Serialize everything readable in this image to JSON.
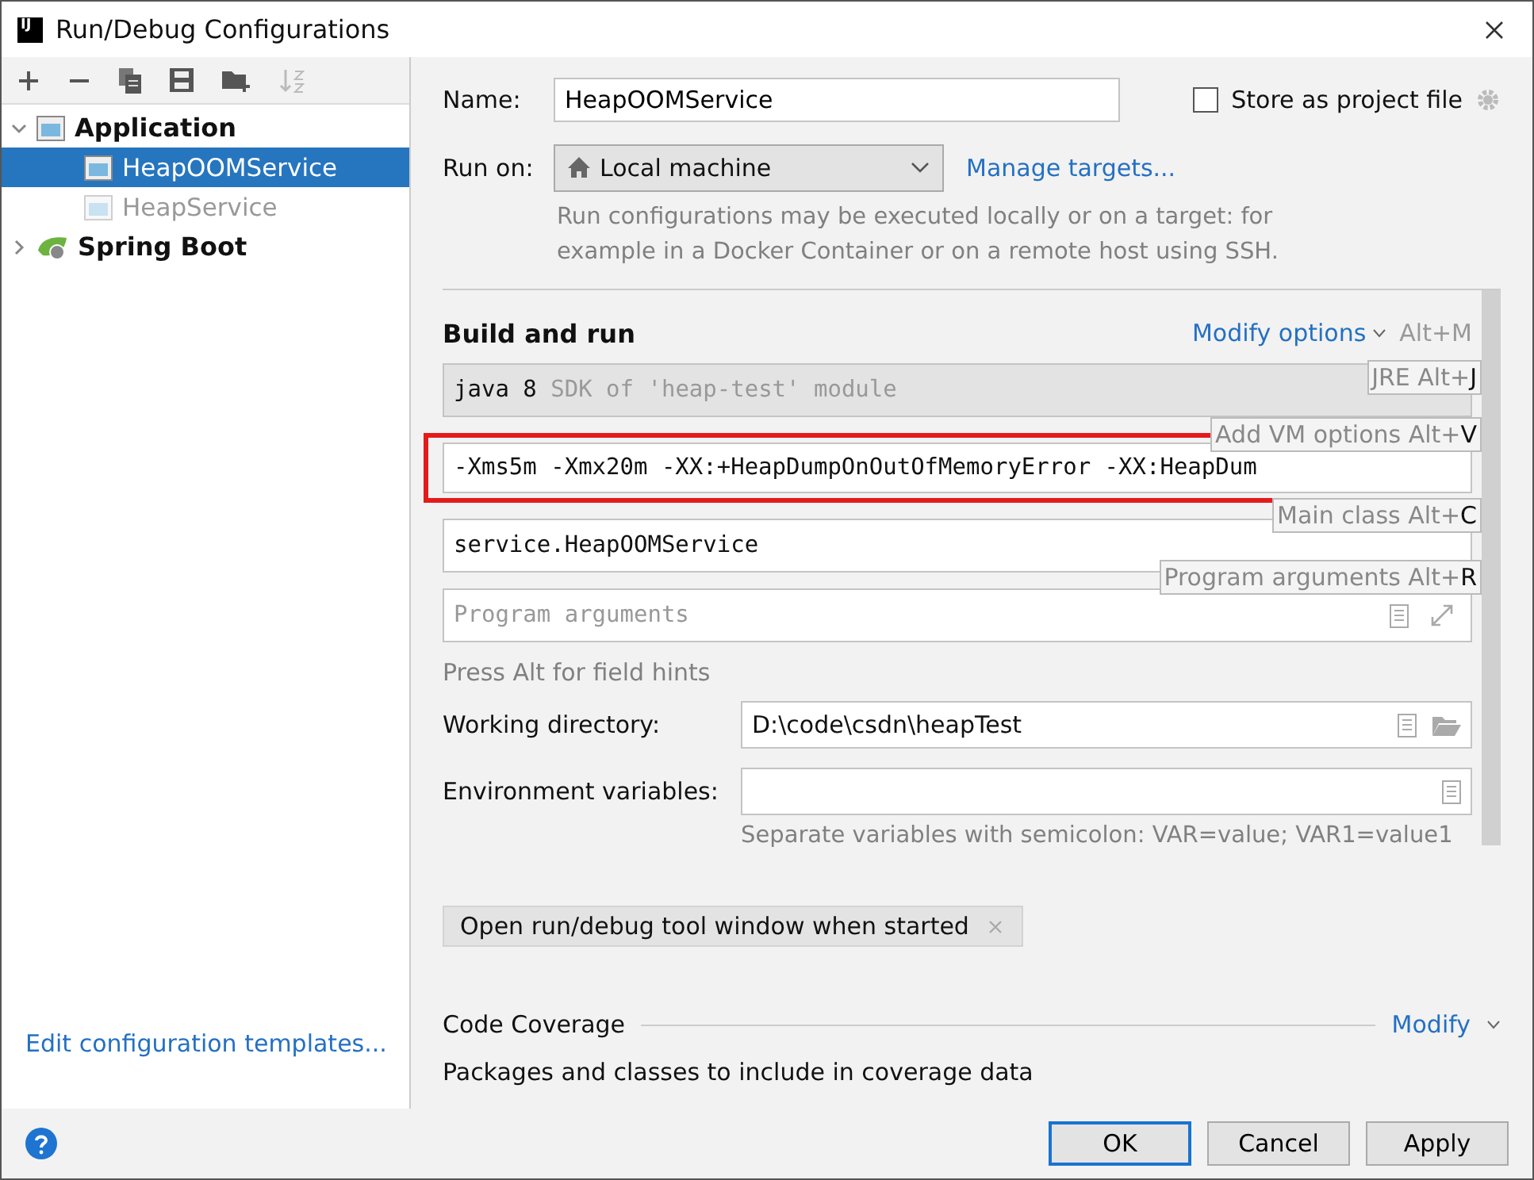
{
  "window": {
    "title": "Run/Debug Configurations",
    "logo": "IJ"
  },
  "tree": [
    {
      "label": "Application",
      "kind": "group",
      "expanded": true,
      "children": [
        {
          "label": "HeapOOMService",
          "selected": true,
          "temporary": false
        },
        {
          "label": "HeapService",
          "selected": false,
          "temporary": true
        }
      ]
    },
    {
      "label": "Spring Boot",
      "kind": "spring",
      "expanded": false
    }
  ],
  "edit_templates_link": "Edit configuration templates...",
  "name": {
    "label": "Name:",
    "value": "HeapOOMService"
  },
  "store_as_project_file": {
    "label": "Store as project file",
    "checked": false
  },
  "run_on": {
    "label": "Run on:",
    "value": "Local machine",
    "link": "Manage targets...",
    "hint": "Run configurations may be executed locally or on a target: for example in a Docker Container or on a remote host using SSH."
  },
  "build_and_run": {
    "title": "Build and run",
    "modify_link": "Modify options",
    "modify_shortcut": "Alt+M",
    "jre": {
      "value": "java 8",
      "hint": "SDK of 'heap-test' module"
    },
    "vm_options": {
      "value": "-Xms5m -Xmx20m -XX:+HeapDumpOnOutOfMemoryError -XX:HeapDum",
      "highlighted": true
    },
    "main_class": {
      "value": "service.HeapOOMService"
    },
    "program_arguments": {
      "placeholder": "Program arguments"
    },
    "tooltips": [
      {
        "text": "JRE Alt+",
        "key": "J"
      },
      {
        "text": "Add VM options Alt+",
        "key": "V"
      },
      {
        "text": "Main class Alt+",
        "key": "C"
      },
      {
        "text": "Program arguments Alt+",
        "key": "R"
      }
    ]
  },
  "field_hints_note": "Press Alt for field hints",
  "working_directory": {
    "label": "Working directory:",
    "value": "D:\\code\\csdn\\heapTest"
  },
  "environment_variables": {
    "label": "Environment variables:",
    "hint": "Separate variables with semicolon: VAR=value; VAR1=value1"
  },
  "option_tags": [
    "Open run/debug tool window when started"
  ],
  "code_coverage": {
    "title": "Code Coverage",
    "modify_link": "Modify",
    "note": "Packages and classes to include in coverage data"
  },
  "buttons": [
    {
      "label": "OK",
      "default": true
    },
    {
      "label": "Cancel",
      "default": false
    },
    {
      "label": "Apply",
      "default": false
    }
  ]
}
